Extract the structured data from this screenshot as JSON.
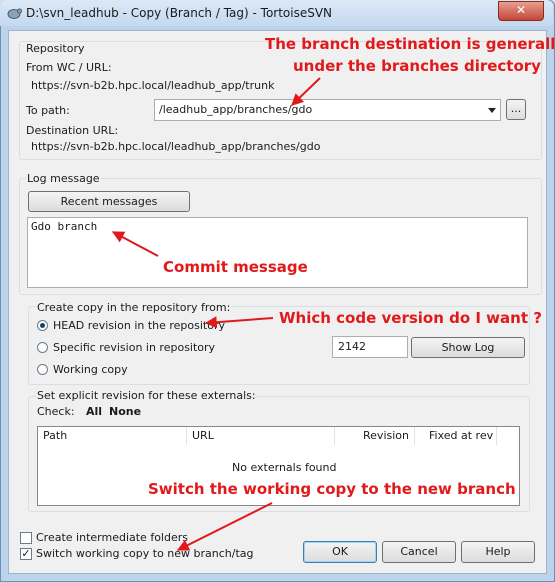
{
  "window": {
    "title": "D:\\svn_leadhub - Copy (Branch / Tag) - TortoiseSVN",
    "close_glyph": "✕"
  },
  "repository": {
    "group_label": "Repository",
    "from_label": "From WC / URL:",
    "from_url": "https://svn-b2b.hpc.local/leadhub_app/trunk",
    "to_path_label": "To path:",
    "to_path_value": "/leadhub_app/branches/gdo",
    "browse_label": "...",
    "dest_label": "Destination URL:",
    "dest_url": "https://svn-b2b.hpc.local/leadhub_app/branches/gdo"
  },
  "log": {
    "group_label": "Log message",
    "recent_button": "Recent messages",
    "message": "Gdo branch"
  },
  "copy_from": {
    "group_label": "Create copy in the repository from:",
    "options": [
      {
        "label": "HEAD revision in the repository",
        "selected": true
      },
      {
        "label": "Specific revision in repository",
        "selected": false
      },
      {
        "label": "Working copy",
        "selected": false
      }
    ],
    "revision_value": "2142",
    "show_log_button": "Show Log"
  },
  "externals": {
    "group_label": "Set explicit revision for these externals:",
    "check_label": "Check:",
    "all_link": "All",
    "none_link": "None",
    "columns": [
      "Path",
      "URL",
      "Revision",
      "Fixed at rev"
    ],
    "empty_text": "No externals found"
  },
  "footer": {
    "create_folders_label": "Create intermediate folders",
    "create_folders_checked": false,
    "switch_label": "Switch working copy to new branch/tag",
    "switch_checked": true,
    "ok_button": "OK",
    "cancel_button": "Cancel",
    "help_button": "Help"
  },
  "annotations": {
    "branch_dest_line1": "The branch destination is generally",
    "branch_dest_line2": "under the branches directory",
    "commit_message": "Commit message",
    "which_version": "Which code version do I want ?",
    "switch_wc": "Switch the working copy to the new branch"
  },
  "colors": {
    "annotation_red": "#e1191b",
    "title_bar": "#c4d8ef",
    "dialog_bg": "#f0f0f0"
  }
}
